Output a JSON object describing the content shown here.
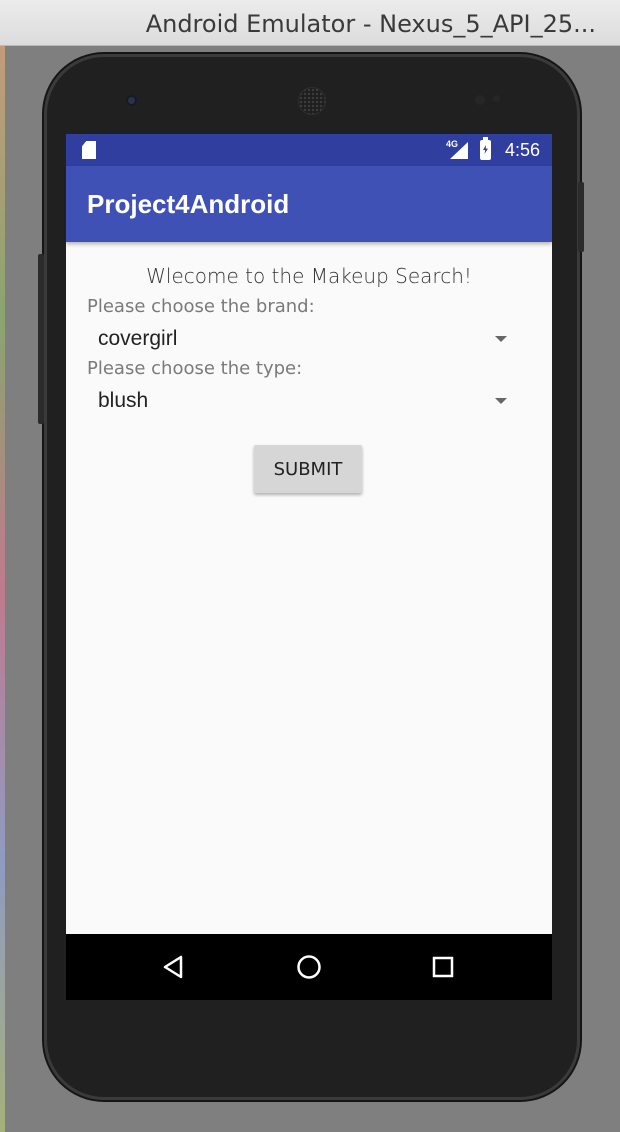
{
  "window": {
    "title": "Android Emulator - Nexus_5_API_25..."
  },
  "statusbar": {
    "network_label": "4G",
    "clock": "4:56",
    "icons": [
      "sd-card-icon",
      "signal-icon",
      "battery-charging-icon"
    ]
  },
  "app": {
    "title": "Project4Android",
    "primary_color": "#3f51b5",
    "status_color": "#303f9f"
  },
  "main": {
    "welcome": "Wlecome to the Makeup Search!",
    "brand_label": "Please choose the brand:",
    "brand_value": "covergirl",
    "type_label": "Please choose the type:",
    "type_value": "blush",
    "submit_label": "SUBMIT"
  },
  "navbar": {
    "icons": [
      "back-icon",
      "home-icon",
      "recents-icon"
    ]
  }
}
